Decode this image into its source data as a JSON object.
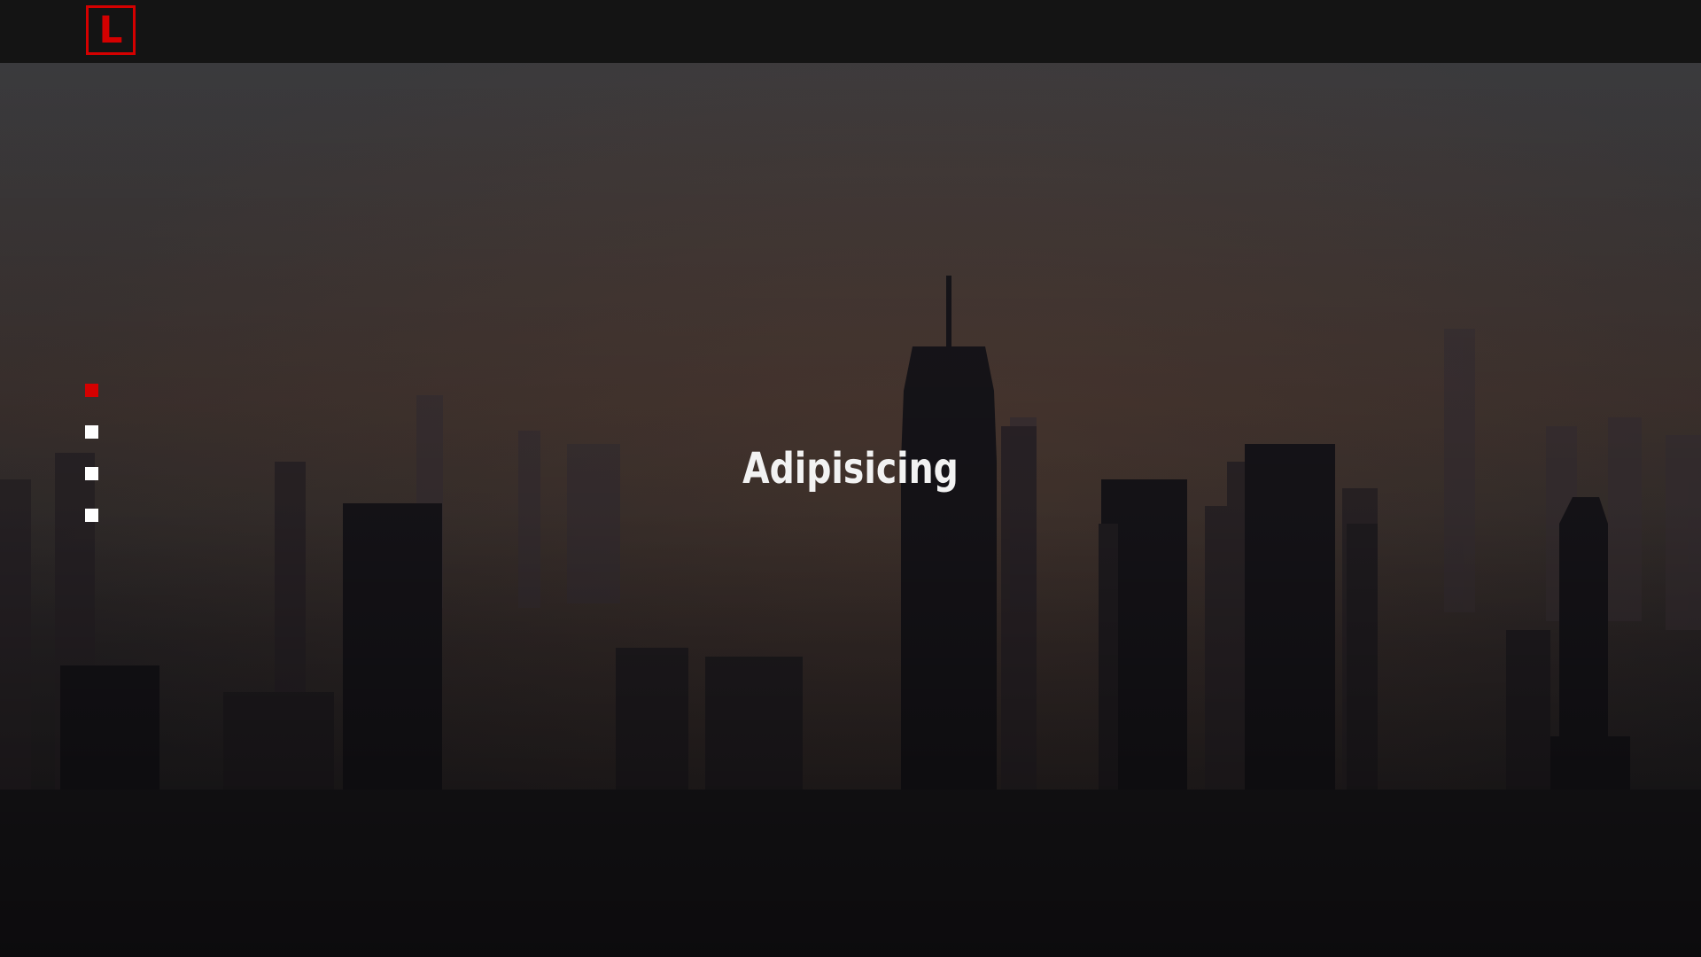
{
  "brand": {
    "logo_letter": "L",
    "accent_color": "#d40000"
  },
  "hero": {
    "title": "Adipisicing",
    "background": "city-skyline-dusk-image"
  },
  "slider": {
    "dots": [
      {
        "label": "slide-1",
        "active": true
      },
      {
        "label": "slide-2",
        "active": false
      },
      {
        "label": "slide-3",
        "active": false
      },
      {
        "label": "slide-4",
        "active": false
      }
    ]
  }
}
